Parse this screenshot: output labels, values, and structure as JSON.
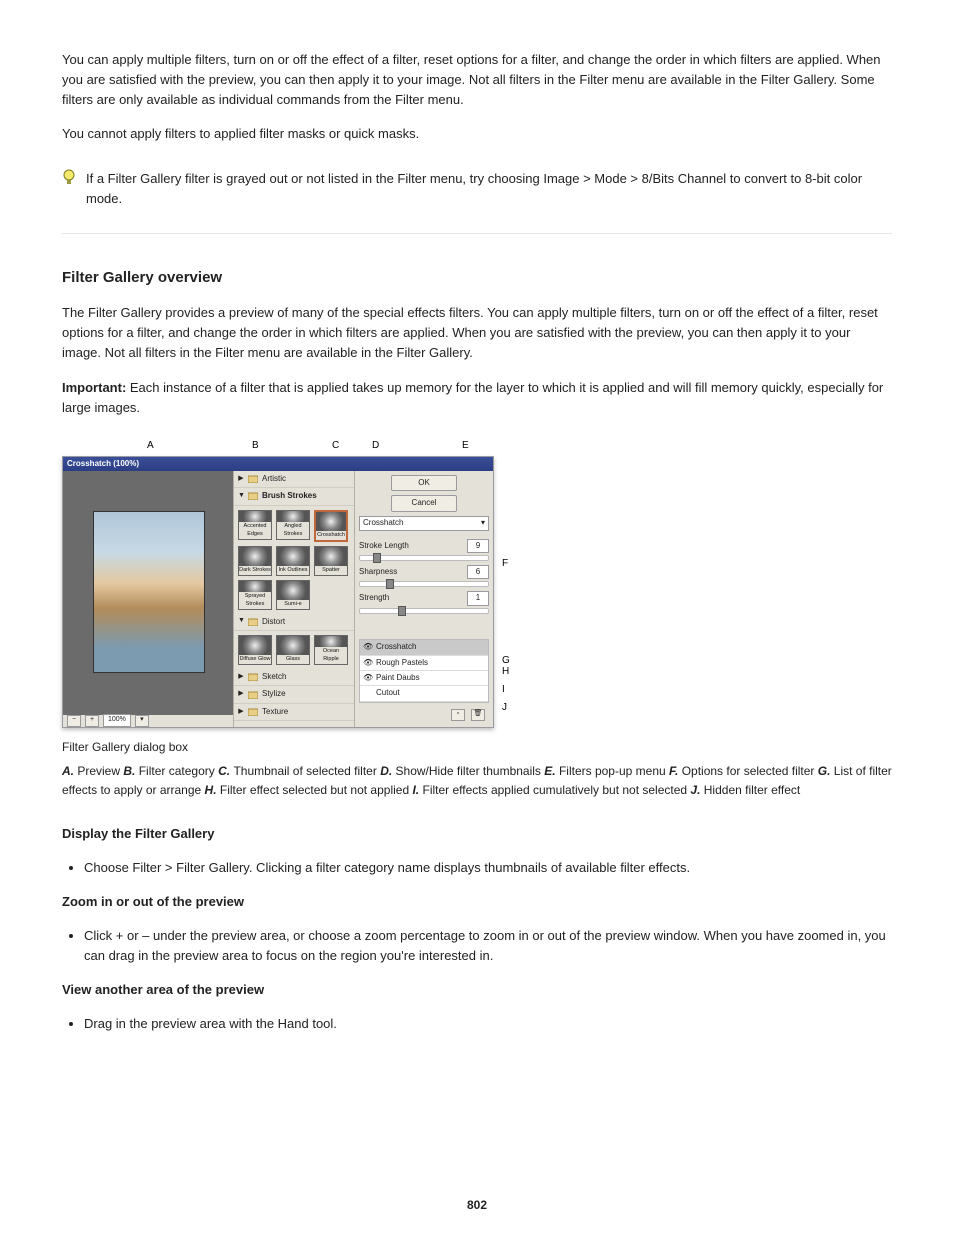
{
  "intro": {
    "p1": "You can apply multiple filters, turn on or off the effect of a filter, reset options for a filter, and change the order in which filters are applied. When you are satisfied with the preview, you can then apply it to your image. Not all filters in the Filter menu are available in the Filter Gallery. Some filters are only available as individual commands from the Filter menu.",
    "p2": "You cannot apply filters to applied filter masks or quick masks.",
    "tip": "If a Filter Gallery filter is grayed out or not listed in the Filter menu, try choosing Image > Mode > 8/Bits Channel to convert to 8-bit color mode."
  },
  "section_title": "Filter Gallery overview",
  "overview": {
    "p1": "The Filter Gallery provides a preview of many of the special effects filters. You can apply multiple filters, turn on or off the effect of a filter, reset options for a filter, and change the order in which filters are applied. When you are satisfied with the preview, you can then apply it to your image. Not all filters in the Filter menu are available in the Filter Gallery.",
    "p2_lead": "Important: ",
    "p2": "Each instance of a filter that is applied takes up memory for the layer to which it is applied and will fill memory quickly, especially for large images."
  },
  "figure": {
    "dialog_title": "Crosshatch (100%)",
    "zoom_value": "100%",
    "callouts_top": {
      "A": "A",
      "B": "B",
      "C": "C",
      "D": "D",
      "E": "E"
    },
    "callouts_side": {
      "F": "F",
      "G": "G",
      "H": "H",
      "I": "I",
      "J": "J"
    },
    "categories": {
      "artistic": "Artistic",
      "brush_strokes": "Brush Strokes",
      "distort": "Distort",
      "sketch": "Sketch",
      "stylize": "Stylize",
      "texture": "Texture"
    },
    "thumbs_bs": [
      "Accented Edges",
      "Angled Strokes",
      "Crosshatch",
      "Dark Strokes",
      "Ink Outlines",
      "Spatter",
      "Sprayed Strokes",
      "Sumi-e"
    ],
    "thumbs_distort": [
      "Diffuse Glow",
      "Glass",
      "Ocean Ripple"
    ],
    "right": {
      "ok": "OK",
      "cancel": "Cancel",
      "current_filter": "Crosshatch",
      "options": [
        {
          "label": "Stroke Length",
          "value": "9"
        },
        {
          "label": "Sharpness",
          "value": "6"
        },
        {
          "label": "Strength",
          "value": "1"
        }
      ],
      "effects": [
        {
          "name": "Crosshatch",
          "visible": true,
          "selected": true
        },
        {
          "name": "Rough Pastels",
          "visible": true,
          "selected": false
        },
        {
          "name": "Paint Daubs",
          "visible": true,
          "selected": false
        },
        {
          "name": "Cutout",
          "visible": false,
          "selected": false
        }
      ]
    },
    "caption_main": "Filter Gallery dialog box",
    "legend": [
      {
        "k": "A.",
        "t": "Preview"
      },
      {
        "k": "B.",
        "t": "Filter category"
      },
      {
        "k": "C.",
        "t": "Thumbnail of selected filter"
      },
      {
        "k": "D.",
        "t": "Show/Hide filter thumbnails"
      },
      {
        "k": "E.",
        "t": "Filters pop-up menu"
      },
      {
        "k": "F.",
        "t": "Options for selected filter"
      },
      {
        "k": "G.",
        "t": "List of filter effects to apply or arrange"
      },
      {
        "k": "H.",
        "t": "Filter effect selected but not applied"
      },
      {
        "k": "I.",
        "t": "Filter effects applied cumulatively but not selected"
      },
      {
        "k": "J.",
        "t": "Hidden filter effect"
      }
    ]
  },
  "post_figure": {
    "display_heading": "Display the Filter Gallery",
    "display_body": "Choose Filter > Filter Gallery. Clicking a filter category name displays thumbnails of available filter effects.",
    "zoom_heading": "Zoom in or out of the preview",
    "zoom_body": "Click + or – under the preview area, or choose a zoom percentage to zoom in or out of the preview window. When you have zoomed in, you can drag in the preview area to focus on the region you're interested in.",
    "view_heading": "View another area of the preview",
    "view_body": "Drag in the preview area with the Hand tool."
  },
  "page_number": "802"
}
